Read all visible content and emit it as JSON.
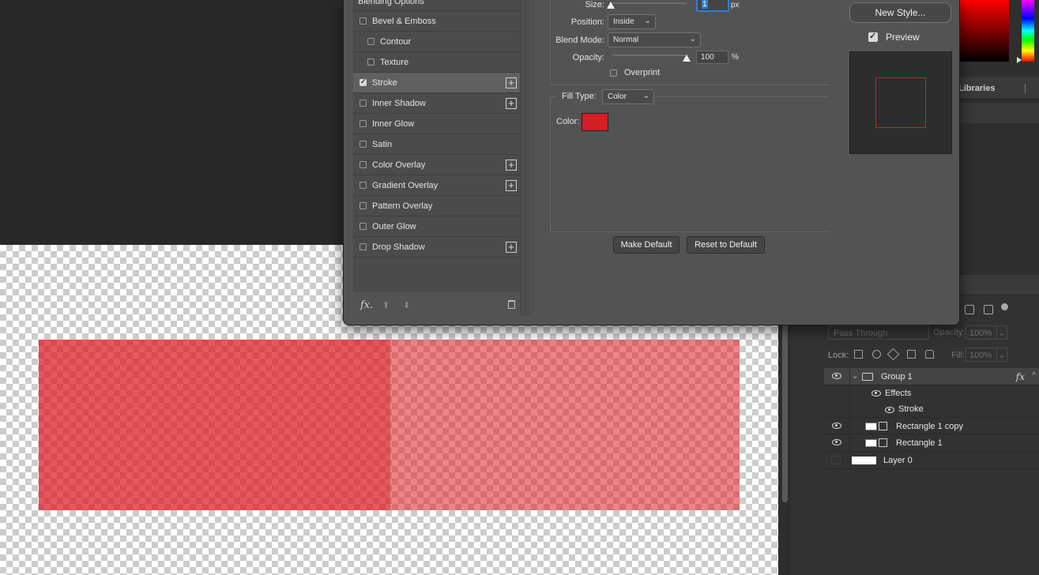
{
  "dialog": {
    "styles": [
      {
        "label": "Blending Options",
        "checked": false,
        "plus": false
      },
      {
        "label": "Bevel & Emboss",
        "checked": false,
        "plus": false
      },
      {
        "label": "Contour",
        "checked": false,
        "plus": false
      },
      {
        "label": "Texture",
        "checked": false,
        "plus": false
      },
      {
        "label": "Stroke",
        "checked": true,
        "plus": true
      },
      {
        "label": "Inner Shadow",
        "checked": false,
        "plus": true
      },
      {
        "label": "Inner Glow",
        "checked": false,
        "plus": false
      },
      {
        "label": "Satin",
        "checked": false,
        "plus": false
      },
      {
        "label": "Color Overlay",
        "checked": false,
        "plus": true
      },
      {
        "label": "Gradient Overlay",
        "checked": false,
        "plus": true
      },
      {
        "label": "Pattern Overlay",
        "checked": false,
        "plus": false
      },
      {
        "label": "Outer Glow",
        "checked": false,
        "plus": false
      },
      {
        "label": "Drop Shadow",
        "checked": false,
        "plus": true
      }
    ],
    "footer": {
      "fx_label": "fx",
      "fx_suffix": "."
    },
    "stroke": {
      "size_label": "Size:",
      "size_value": "1",
      "size_unit": "px",
      "position_label": "Position:",
      "position_value": "Inside",
      "blend_mode_label": "Blend Mode:",
      "blend_mode_value": "Normal",
      "opacity_label": "Opacity:",
      "opacity_value": "100",
      "opacity_unit": "%",
      "opacity_level": 1.0,
      "overprint_label": "Overprint",
      "overprint_checked": false,
      "fill_type_label": "Fill Type:",
      "fill_type_value": "Color",
      "color_label": "Color:",
      "color_value": "#d51e26"
    },
    "buttons": {
      "make_default": "Make Default",
      "reset_default": "Reset to Default",
      "new_style": "New Style..."
    },
    "preview": {
      "label": "Preview",
      "checked": true
    }
  },
  "panels": {
    "libraries_tab": "Libraries",
    "layers": {
      "blend_mode": "Pass Through",
      "opacity_label": "Opacity:",
      "opacity_value": "100%",
      "lock_label": "Lock:",
      "fill_label": "Fill:",
      "fill_value": "100%",
      "items": [
        {
          "name": "Group 1",
          "type": "group",
          "visible": true,
          "fx": "fx"
        },
        {
          "name": "Effects",
          "type": "effects",
          "visible": true
        },
        {
          "name": "Stroke",
          "type": "effect",
          "visible": true
        },
        {
          "name": "Rectangle 1 copy",
          "type": "shape",
          "visible": true
        },
        {
          "name": "Rectangle 1",
          "type": "shape",
          "visible": true
        },
        {
          "name": "Layer 0",
          "type": "pixel",
          "visible": false
        }
      ]
    }
  },
  "colors": {
    "accent_red": "#d51e26",
    "dialog_bg": "#535353",
    "focus_blue": "#2f7ed8"
  }
}
